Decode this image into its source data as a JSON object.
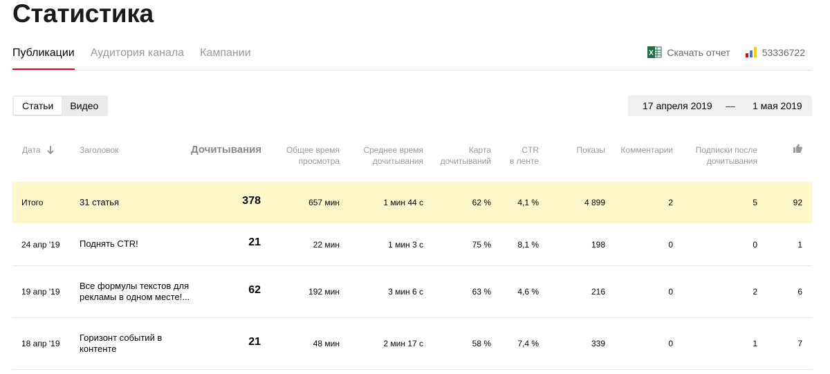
{
  "page_title": "Статистика",
  "tabs": [
    {
      "label": "Публикации",
      "active": true
    },
    {
      "label": "Аудитория канала",
      "active": false
    },
    {
      "label": "Кампании",
      "active": false
    }
  ],
  "actions": {
    "download_label": "Скачать отчет",
    "download_icon": "excel-icon",
    "counter_label": "53336722",
    "counter_icon": "bar-chart-icon"
  },
  "content_type": {
    "options": [
      "Статьи",
      "Видео"
    ],
    "selected": "Статьи"
  },
  "date_range": {
    "from": "17 апреля 2019",
    "separator": "—",
    "to": "1 мая 2019"
  },
  "table": {
    "headers": {
      "date": "Дата",
      "title": "Заголовок",
      "reads": "Дочитывания",
      "total_time_1": "Общее время",
      "total_time_2": "просмотра",
      "avg_time_1": "Среднее время",
      "avg_time_2": "дочитывания",
      "map_1": "Карта",
      "map_2": "дочитываний",
      "ctr_1": "CTR",
      "ctr_2": "в ленте",
      "shows": "Показы",
      "comments": "Комментарии",
      "subs_1": "Подписки после",
      "subs_2": "дочитывания",
      "likes_icon": "thumbs-up-icon"
    },
    "total": {
      "date": "Итого",
      "title": "31 статья",
      "reads": "378",
      "total_time": "657 мин",
      "avg_time": "1 мин 44 с",
      "map": "62 %",
      "ctr": "4,1 %",
      "shows": "4 899",
      "comments": "2",
      "subs": "5",
      "likes": "92"
    },
    "rows": [
      {
        "date": "24 апр '19",
        "title_1": "Поднять CTR!",
        "title_2": "",
        "reads": "21",
        "total_time": "22 мин",
        "avg_time": "1 мин 3 с",
        "map": "75 %",
        "ctr": "8,1 %",
        "shows": "198",
        "comments": "0",
        "subs": "0",
        "likes": "1"
      },
      {
        "date": "19 апр '19",
        "title_1": "Все формулы текстов для",
        "title_2": "рекламы в одном месте!...",
        "reads": "62",
        "total_time": "192 мин",
        "avg_time": "3 мин 6 с",
        "map": "63 %",
        "ctr": "4,6 %",
        "shows": "216",
        "comments": "0",
        "subs": "2",
        "likes": "6"
      },
      {
        "date": "18 апр '19",
        "title_1": "Горизонт событий в",
        "title_2": "контенте",
        "reads": "21",
        "total_time": "48 мин",
        "avg_time": "2 мин 17 с",
        "map": "58 %",
        "ctr": "7,4 %",
        "shows": "339",
        "comments": "0",
        "subs": "1",
        "likes": "7"
      }
    ]
  },
  "colors": {
    "accent": "#e2001a",
    "total_row_bg": "#fdf7c9",
    "muted_text": "#999999"
  }
}
